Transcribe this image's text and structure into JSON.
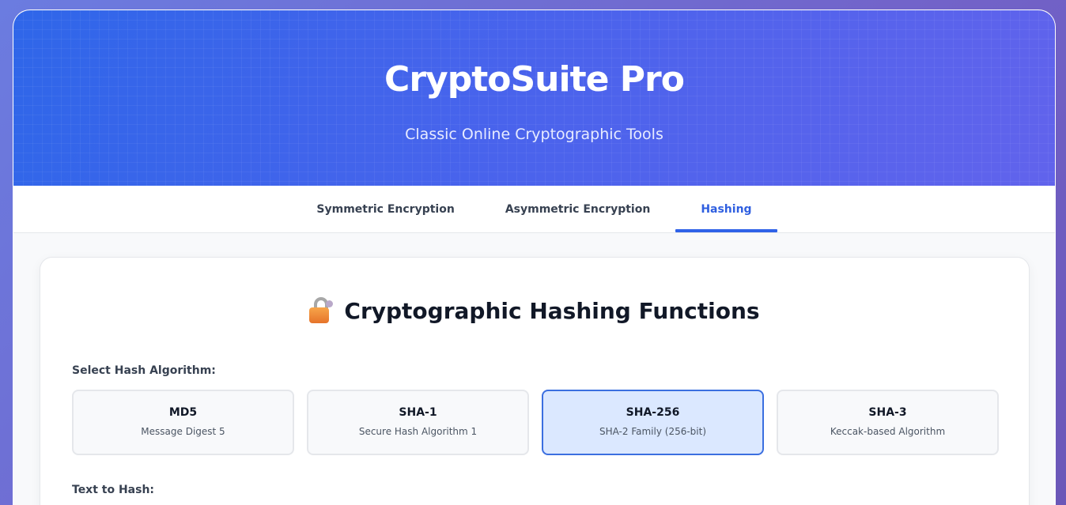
{
  "header": {
    "title": "CryptoSuite Pro",
    "subtitle": "Classic Online Cryptographic Tools"
  },
  "tabs": [
    {
      "label": "Symmetric Encryption",
      "active": false
    },
    {
      "label": "Asymmetric Encryption",
      "active": false
    },
    {
      "label": "Hashing",
      "active": true
    }
  ],
  "hashing": {
    "title": "Cryptographic Hashing Functions",
    "title_icon": "lock-with-key-icon",
    "select_label": "Select Hash Algorithm:",
    "algorithms": [
      {
        "name": "MD5",
        "description": "Message Digest 5",
        "selected": false
      },
      {
        "name": "SHA-1",
        "description": "Secure Hash Algorithm 1",
        "selected": false
      },
      {
        "name": "SHA-256",
        "description": "SHA-2 Family (256-bit)",
        "selected": true
      },
      {
        "name": "SHA-3",
        "description": "Keccak-based Algorithm",
        "selected": false
      }
    ],
    "input_label": "Text to Hash:"
  },
  "colors": {
    "accent": "#2f62e8",
    "selected_bg": "#dbe8ff",
    "hero_start": "#2f66e9",
    "hero_end": "#6163ec"
  }
}
